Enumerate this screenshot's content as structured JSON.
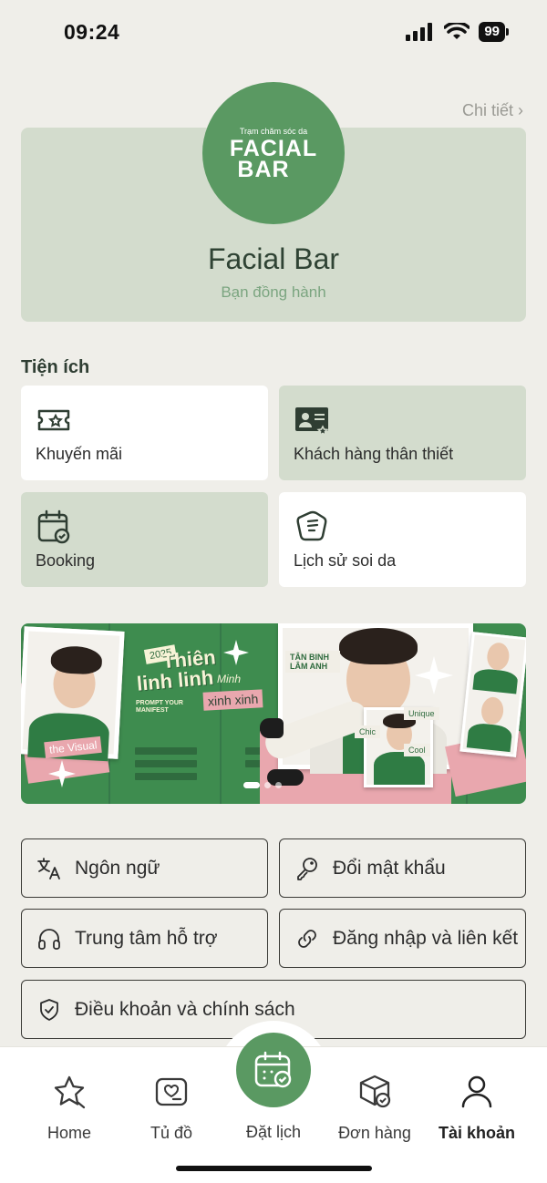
{
  "status_bar": {
    "time": "09:24",
    "battery": "99"
  },
  "profile": {
    "detail_link": "Chi tiết ›",
    "logo_small": "Trạm chăm sóc da",
    "logo_big_line1": "FACIAL",
    "logo_big_line2": "BAR",
    "name": "Facial Bar",
    "subtitle": "Bạn đồng hành"
  },
  "utilities": {
    "title": "Tiện ích",
    "tiles": [
      {
        "label": "Khuyến mãi",
        "icon": "voucher-icon"
      },
      {
        "label": "Khách hàng thân thiết",
        "icon": "member-card-icon"
      },
      {
        "label": "Booking",
        "icon": "calendar-check-icon"
      },
      {
        "label": "Lịch sử soi da",
        "icon": "skin-scan-icon"
      }
    ]
  },
  "banner": {
    "title_line1": "Thiên",
    "title_line2": "linh linh",
    "tag_visual": "the Visual",
    "tag_xinh": "xinh xinh",
    "tag_minh": "Minh",
    "tag_year": "2025",
    "tag_prompt": "PROMPT YOUR MANIFEST",
    "tag_tanbinh": "TÂN BINH LÂM ANH",
    "tag_chic": "Chic",
    "tag_unique": "Unique",
    "tag_cool": "Cool"
  },
  "settings": [
    {
      "label": "Ngôn ngữ",
      "icon": "translate-icon"
    },
    {
      "label": "Đổi mật khẩu",
      "icon": "key-icon"
    },
    {
      "label": "Trung tâm hỗ trợ",
      "icon": "headphones-icon"
    },
    {
      "label": "Đăng nhập và liên kết",
      "icon": "link-icon"
    },
    {
      "label": "Điều khoản và chính sách",
      "icon": "shield-check-icon"
    }
  ],
  "bottom_nav": {
    "items": [
      {
        "label": "Home",
        "icon": "star-icon"
      },
      {
        "label": "Tủ đồ",
        "icon": "wardrobe-icon"
      },
      {
        "label": "Đặt lịch",
        "icon": "calendar-icon"
      },
      {
        "label": "Đơn hàng",
        "icon": "box-icon"
      },
      {
        "label": "Tài khoản",
        "icon": "user-icon",
        "active": true
      }
    ]
  },
  "colors": {
    "brand_green": "#5a9962",
    "card_green": "#d3dccd",
    "background": "#efeee9"
  }
}
